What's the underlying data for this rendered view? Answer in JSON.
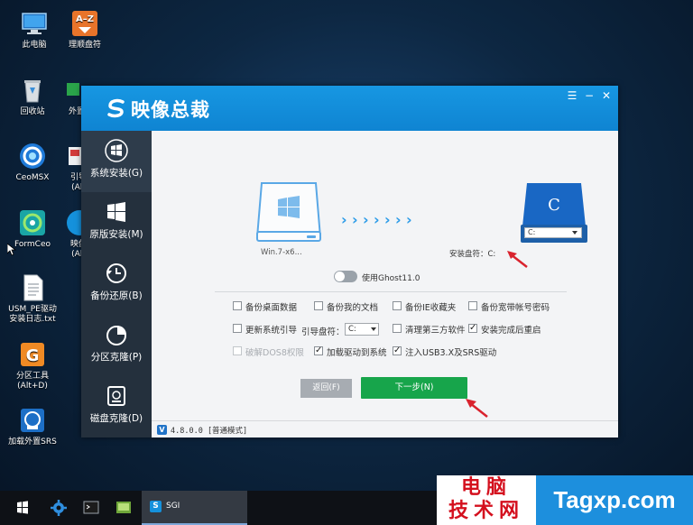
{
  "desktop": {
    "icons": [
      {
        "label": "此电脑",
        "icon": "computer-icon"
      },
      {
        "label": "理顺盘符",
        "icon": "az-sort-icon"
      },
      {
        "label": "回收站",
        "icon": "recycle-bin-icon"
      },
      {
        "label": "外置",
        "icon": "external-icon"
      },
      {
        "label": "CeoMSX",
        "icon": "ceomsx-icon"
      },
      {
        "label": "引导",
        "label2": "(Alt",
        "icon": "boot-icon"
      },
      {
        "label": "FormCeo",
        "icon": "formceo-icon"
      },
      {
        "label": "映像",
        "label2": "(Alt",
        "icon": "image-icon"
      },
      {
        "label": "USM_PE驱动",
        "label2": "安装日志.txt",
        "icon": "text-file-icon"
      },
      {
        "label": "分区工具",
        "label2": "(Alt+D)",
        "icon": "partition-tool-icon"
      },
      {
        "label": "加载外置SRS",
        "icon": "srs-icon"
      }
    ]
  },
  "window": {
    "title": "映像总裁",
    "menu_icon": "menu-icon",
    "minimize": "minimize-icon",
    "close": "close-icon"
  },
  "sidebar": {
    "items": [
      {
        "label": "系统安装(G)",
        "icon": "windows-logo-icon",
        "active": true
      },
      {
        "label": "原版安装(M)",
        "icon": "windows-grid-icon",
        "active": false
      },
      {
        "label": "备份还原(B)",
        "icon": "backup-clock-icon",
        "active": false
      },
      {
        "label": "分区克隆(P)",
        "icon": "pie-chart-icon",
        "active": false
      },
      {
        "label": "磁盘克隆(D)",
        "icon": "disk-icon",
        "active": false
      }
    ]
  },
  "main": {
    "source_label": "Win.7-x6...",
    "target_letter": "C",
    "target_drive_select": "C:",
    "target_label": "安装盘符：C:",
    "ghost_label": "使用Ghost11.0",
    "options": {
      "row1": [
        {
          "label": "备份桌面数据",
          "checked": false,
          "disabled": false
        },
        {
          "label": "备份我的文档",
          "checked": false,
          "disabled": false
        },
        {
          "label": "备份IE收藏夹",
          "checked": false,
          "disabled": false
        },
        {
          "label": "备份宽带帐号密码",
          "checked": false,
          "disabled": false
        }
      ],
      "row2": [
        {
          "label": "更新系统引导",
          "checked": false,
          "disabled": false
        },
        {
          "label": "清理第三方软件",
          "checked": false,
          "disabled": false
        },
        {
          "label": "安装完成后重启",
          "checked": true,
          "disabled": false
        }
      ],
      "row3": [
        {
          "label": "破解DOS8权限",
          "checked": false,
          "disabled": true
        },
        {
          "label": "加载驱动到系统",
          "checked": true,
          "disabled": false
        },
        {
          "label": "注入USB3.X及SRS驱动",
          "checked": true,
          "disabled": false
        }
      ],
      "boot_label": "引导盘符：",
      "boot_value": "C:"
    },
    "back_button": "返回(F)",
    "next_button": "下一步(N)"
  },
  "status": {
    "badge": "V",
    "version": "4.8.0.0 [普通模式]"
  },
  "taskbar": {
    "sgi_label": "SGI",
    "sgi_icon_letter": "S"
  },
  "watermark": {
    "line1": "电脑",
    "line2": "技术网",
    "site": "Tagxp.com"
  },
  "colors": {
    "title_blue": "#1591dc",
    "sidebar_dark": "#24303d",
    "next_green": "#17a54b",
    "arrow_red": "#d9232e"
  }
}
